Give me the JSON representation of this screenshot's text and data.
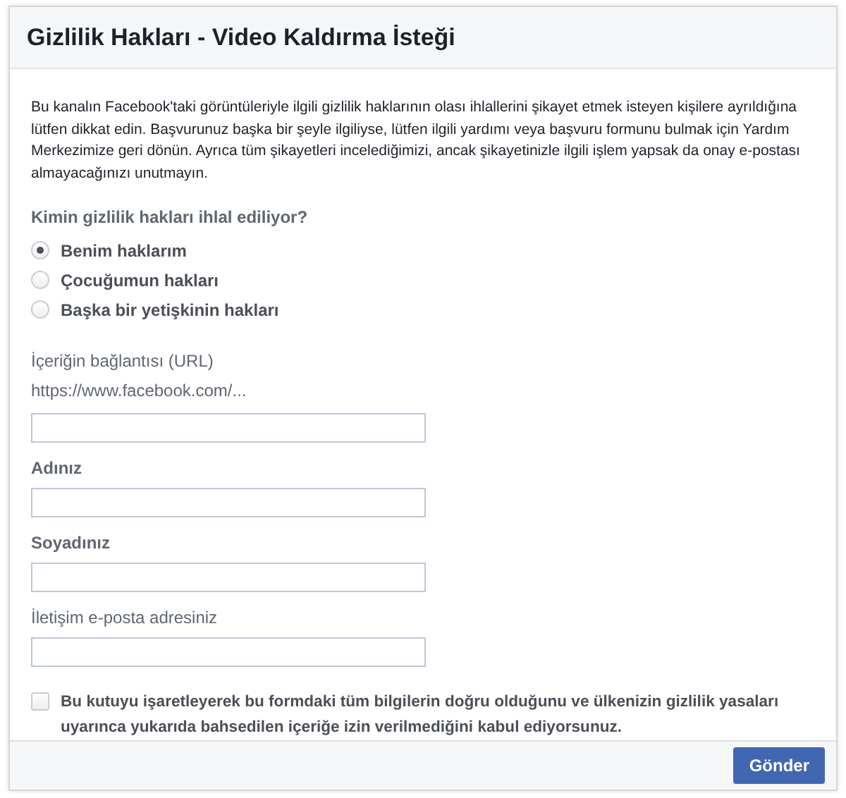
{
  "dialog": {
    "title": "Gizlilik Hakları - Video Kaldırma İsteği",
    "intro": "Bu kanalın Facebook'taki görüntüleriyle ilgili gizlilik haklarının olası ihlallerini şikayet etmek isteyen kişilere ayrıldığına lütfen dikkat edin. Başvurunuz başka bir şeyle ilgiliyse, lütfen ilgili yardımı veya başvuru formunu bulmak için Yardım Merkezimize geri dönün. Ayrıca tüm şikayetleri incelediğimizi, ancak şikayetinizle ilgili işlem yapsak da onay e-postası almayacağınızı unutmayın.",
    "question": "Kimin gizlilik hakları ihlal ediliyor?",
    "options": [
      {
        "label": "Benim haklarım",
        "selected": true
      },
      {
        "label": "Çocuğumun hakları",
        "selected": false
      },
      {
        "label": "Başka bir yetişkinin hakları",
        "selected": false
      }
    ],
    "fields": [
      {
        "label": "İçeriğin bağlantısı (URL)",
        "bold": false,
        "hint": "https://www.facebook.com/..."
      },
      {
        "label": "Adınız",
        "bold": true
      },
      {
        "label": "Soyadınız",
        "bold": true
      },
      {
        "label": "İletişim e-posta adresiniz",
        "bold": false
      }
    ],
    "consent": {
      "label": "Bu kutuyu işaretleyerek bu formdaki tüm bilgilerin doğru olduğunu ve ülkenizin gizlilik yasaları uyarınca yukarıda bahsedilen içeriğe izin verilmediğini kabul ediyorsunuz.",
      "checked": false
    },
    "submit": "Gönder"
  }
}
